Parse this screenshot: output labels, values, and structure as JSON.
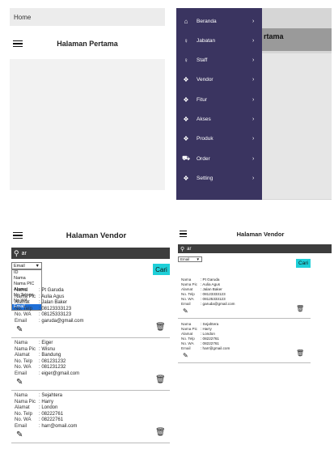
{
  "home_screen": {
    "top_label": "Home",
    "title": "Halaman Pertama"
  },
  "drawer_screen": {
    "behind_title": "rtama",
    "menu": [
      {
        "label": "Beranda",
        "icon": "home-icon"
      },
      {
        "label": "Jabatan",
        "icon": "user-icon"
      },
      {
        "label": "Staff",
        "icon": "user-icon"
      },
      {
        "label": "Vendor",
        "icon": "dropbox-icon"
      },
      {
        "label": "Fitur",
        "icon": "dropbox-icon"
      },
      {
        "label": "Akses",
        "icon": "dropbox-icon"
      },
      {
        "label": "Produk",
        "icon": "dropbox-icon"
      },
      {
        "label": "Order",
        "icon": "cart-icon"
      },
      {
        "label": "Setting",
        "icon": "dropbox-icon"
      }
    ]
  },
  "vendor_left": {
    "title": "Halaman Vendor",
    "search_value": "ar",
    "filter_selected": "Email",
    "filter_options": [
      "ID",
      "Nama",
      "Nama PIC",
      "Alamat",
      "No Telpon",
      "No WA",
      "Email"
    ],
    "search_button": "Cari",
    "labels": {
      "nama": "Nama",
      "pic": "Nama Pic",
      "alamat": "Alamat",
      "telp": "No. Telp",
      "wa": "No. WA",
      "email": "Email"
    },
    "vendors": [
      {
        "nama": ": Pt Garuda",
        "pic": ": Aulia Agus",
        "alamat": ": Jalan Baker",
        "telp": ": 08123333123",
        "wa": ": 08125333123",
        "email": ": garuda@gmail.com"
      },
      {
        "nama": ": Eiger",
        "pic": ": Wisnu",
        "alamat": ": Bandung",
        "telp": ": 081231232",
        "wa": ": 081231232",
        "email": ": eiger@gmail.com"
      },
      {
        "nama": ": Sejahtera",
        "pic": ": Harry",
        "alamat": ": London",
        "telp": ": 08222761",
        "wa": ": 08222761",
        "email": ": harr@omail.com"
      }
    ]
  },
  "vendor_right": {
    "title": "Halaman Vendor",
    "search_value": "ar",
    "filter_selected": "Email",
    "search_button": "Cari",
    "labels": {
      "nama": "Nama",
      "pic": "Nama Pic",
      "alamat": "Alamat",
      "telp": "No. Telp",
      "wa": "No. WA",
      "email": "Email"
    },
    "vendors": [
      {
        "nama": ": Pt Garuda",
        "pic": ": Aulia Agus",
        "alamat": ": Jalan Baker",
        "telp": ": 08123333123",
        "wa": ": 08125333123",
        "email": ": garuda@gmail.com"
      },
      {
        "nama": ": Sejahtera",
        "pic": ": Harry",
        "alamat": ": London",
        "telp": ": 08222761",
        "wa": ": 08222761",
        "email": ": harr@gmail.com"
      }
    ]
  },
  "colors": {
    "drawer": "#3a3460",
    "cari": "#1ecfd8",
    "search_bar": "#3d3d3d",
    "highlight": "#1e6fd8"
  }
}
